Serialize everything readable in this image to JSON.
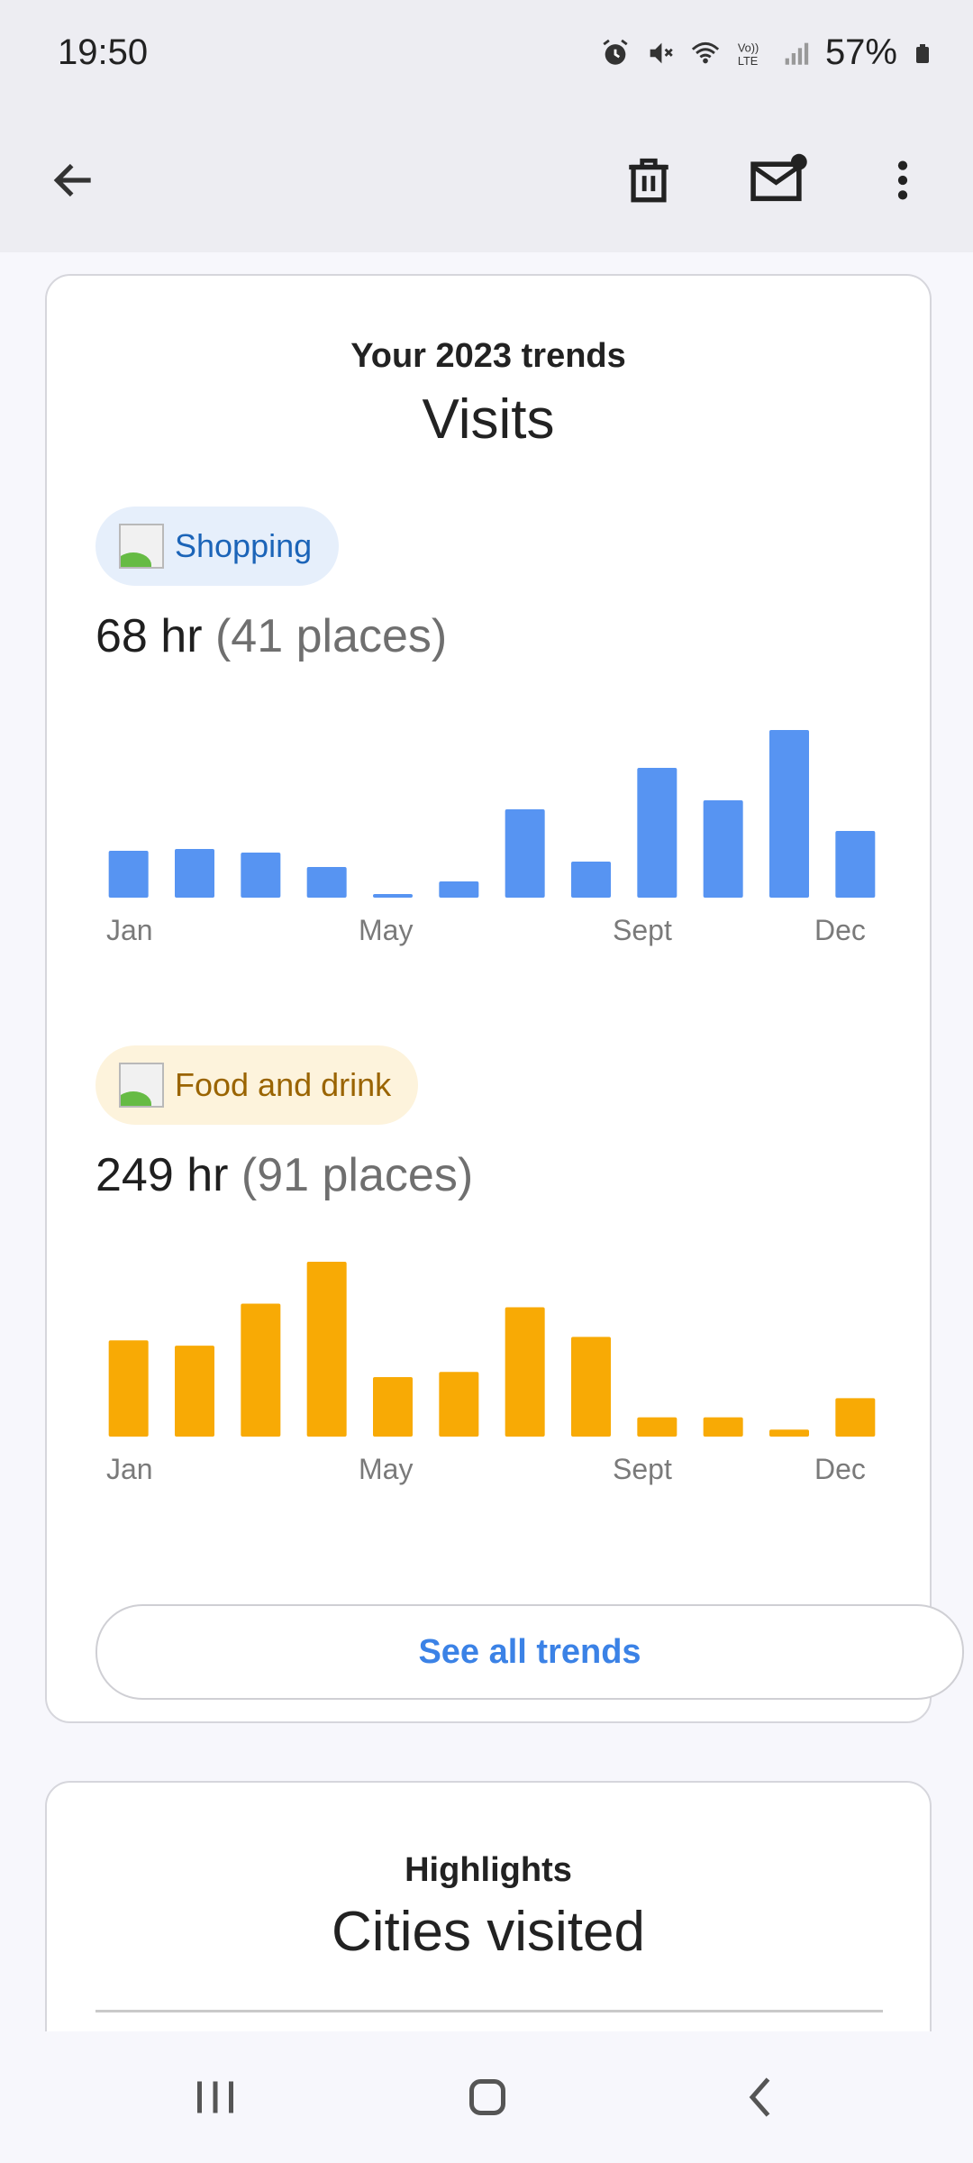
{
  "status_bar": {
    "time": "19:50",
    "battery": "57%",
    "icons": [
      "alarm-icon",
      "mute-icon",
      "wifi-icon",
      "volte-icon",
      "signal-icon",
      "battery-icon"
    ]
  },
  "app_bar": {
    "icons": [
      "back-arrow-icon",
      "trash-icon",
      "mail-unread-icon",
      "more-vert-icon"
    ]
  },
  "trends_card": {
    "subtitle": "Your 2023 trends",
    "title": "Visits",
    "sections": [
      {
        "chip_label": "Shopping",
        "hours": "68 hr",
        "places": "(41 places)",
        "months": [
          "Jan",
          "May",
          "Sept",
          "Dec"
        ]
      },
      {
        "chip_label": "Food and drink",
        "hours": "249 hr",
        "places": "(91 places)",
        "months": [
          "Jan",
          "May",
          "Sept",
          "Dec"
        ]
      }
    ],
    "see_all_label": "See all trends"
  },
  "highlights_card": {
    "subtitle": "Highlights",
    "title": "Cities visited"
  },
  "nav_bar": {
    "icons": [
      "recents-icon",
      "home-icon",
      "back-icon"
    ]
  },
  "colors": {
    "shopping": "#5794f2",
    "food": "#f8aa05",
    "accent": "#3b82e6"
  },
  "chart_data": [
    {
      "type": "bar",
      "series": [
        {
          "name": "Shopping",
          "values": [
            26,
            27,
            25,
            17,
            2,
            9,
            49,
            20,
            72,
            54,
            93,
            37
          ]
        }
      ],
      "categories": [
        "Jan",
        "Feb",
        "Mar",
        "Apr",
        "May",
        "Jun",
        "Jul",
        "Aug",
        "Sept",
        "Oct",
        "Nov",
        "Dec"
      ],
      "tick_labels": [
        "Jan",
        "May",
        "Sept",
        "Dec"
      ],
      "ylim": [
        0,
        100
      ]
    },
    {
      "type": "bar",
      "series": [
        {
          "name": "Food and drink",
          "values": [
            55,
            52,
            76,
            100,
            34,
            37,
            74,
            57,
            11,
            11,
            4,
            22
          ]
        }
      ],
      "categories": [
        "Jan",
        "Feb",
        "Mar",
        "Apr",
        "May",
        "Jun",
        "Jul",
        "Aug",
        "Sept",
        "Oct",
        "Nov",
        "Dec"
      ],
      "tick_labels": [
        "Jan",
        "May",
        "Sept",
        "Dec"
      ],
      "ylim": [
        0,
        100
      ]
    }
  ]
}
